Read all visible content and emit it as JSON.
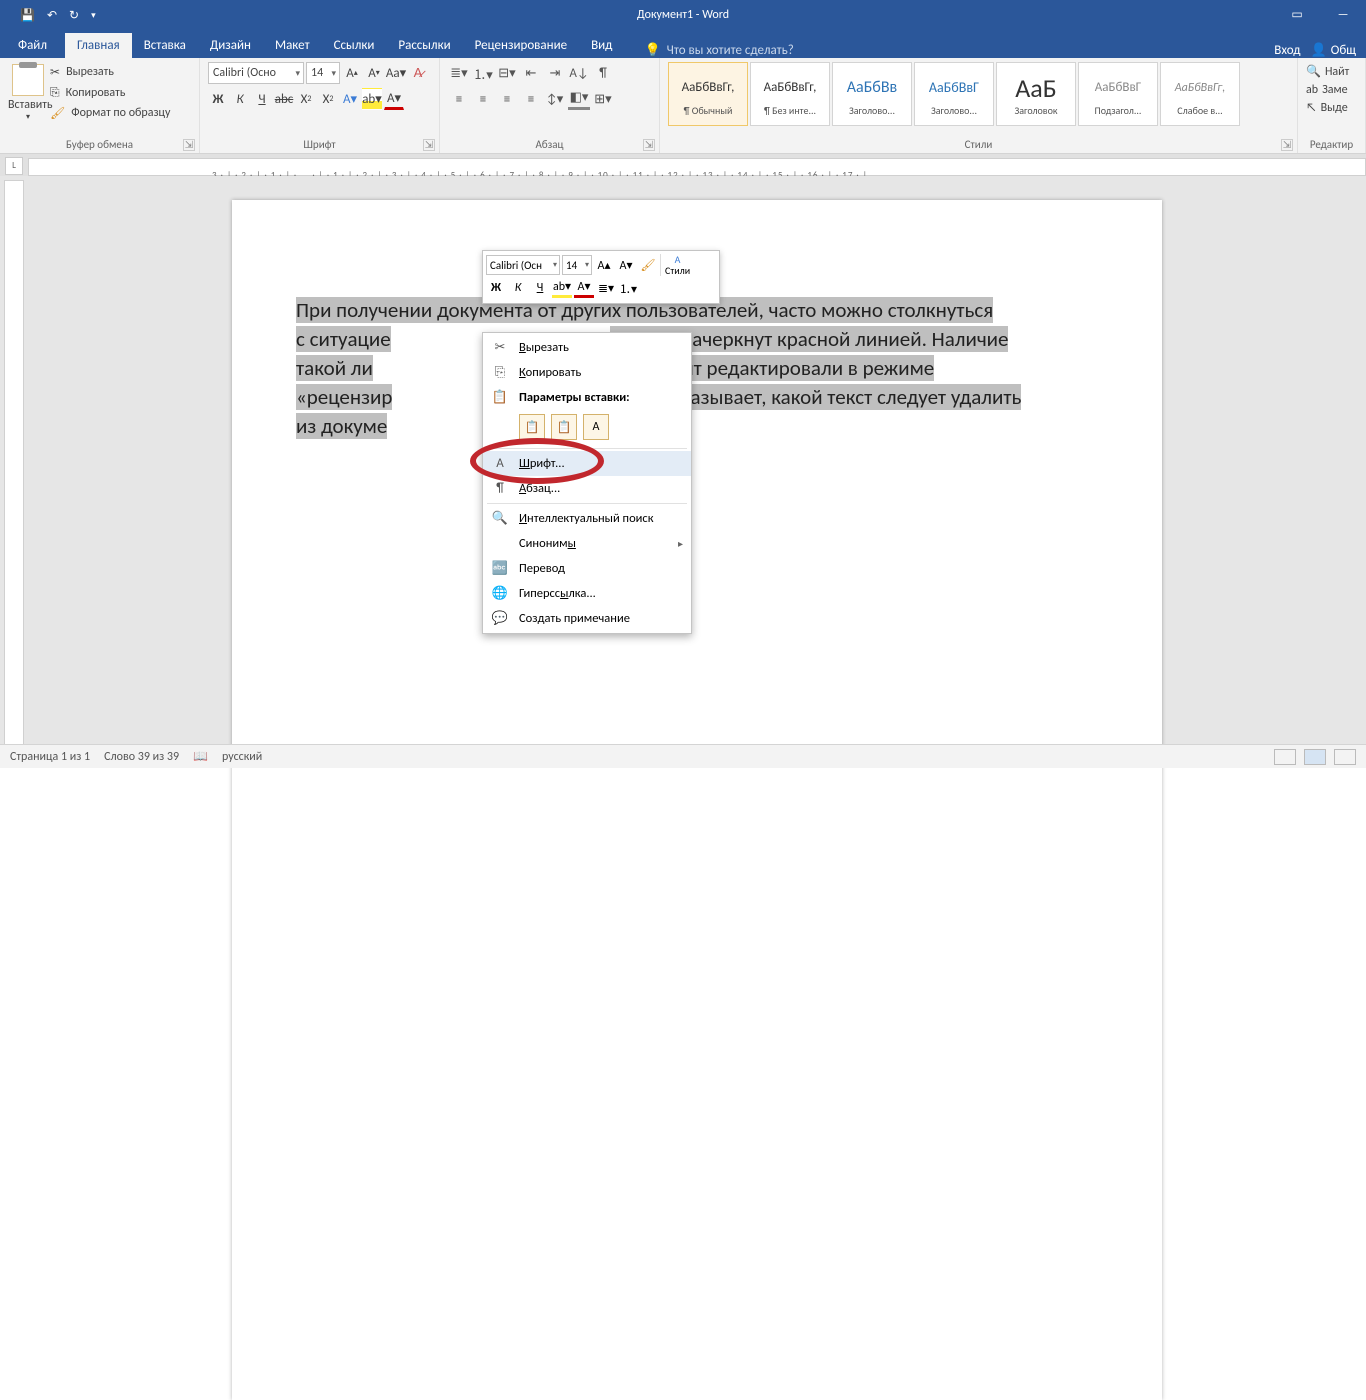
{
  "titlebar": {
    "title": "Документ1 - Word"
  },
  "tabs": {
    "file": "Файл",
    "items": [
      "Главная",
      "Вставка",
      "Дизайн",
      "Макет",
      "Ссылки",
      "Рассылки",
      "Рецензирование",
      "Вид"
    ],
    "tell_me": "Что вы хотите сделать?",
    "signin": "Вход",
    "share": "Общ"
  },
  "clipboard": {
    "paste": "Вставить",
    "cut": "Вырезать",
    "copy": "Копировать",
    "format_painter": "Формат по образцу",
    "group": "Буфер обмена"
  },
  "font": {
    "name": "Calibri (Осно",
    "size": "14",
    "group": "Шрифт"
  },
  "paragraph": {
    "group": "Абзац"
  },
  "styles": {
    "group": "Стили",
    "items": [
      {
        "preview": "АаБбВвГг,",
        "name": "¶ Обычный",
        "sel": true,
        "color": "#333",
        "fs": "13px"
      },
      {
        "preview": "АаБбВвГг,",
        "name": "¶ Без инте...",
        "color": "#333",
        "fs": "13px"
      },
      {
        "preview": "АаБбВв",
        "name": "Заголово...",
        "color": "#2e74b5",
        "fs": "16px"
      },
      {
        "preview": "АаБбВвГ",
        "name": "Заголово...",
        "color": "#2e74b5",
        "fs": "14px"
      },
      {
        "preview": "АаБ",
        "name": "Заголовок",
        "color": "#333",
        "fs": "26px"
      },
      {
        "preview": "АаБбВвГ",
        "name": "Подзагол...",
        "color": "#888",
        "fs": "13px"
      },
      {
        "preview": "АаБбВвГг,",
        "name": "Слабое в...",
        "color": "#888",
        "fs": "12px",
        "italic": true
      }
    ]
  },
  "editing": {
    "find": "Найт",
    "replace": "Заме",
    "select": "Выде",
    "group": "Редактир"
  },
  "document": {
    "line1a": "При получении документа от других пользователей, часто можно столкнуться",
    "line2a": "с ситуацие",
    "line2b": "сь текст зачеркнут красной линией. Наличие",
    "line3a": "такой   ли",
    "line3b": "то   документ   редактировали   в   режиме",
    "line4a": "«рецензир",
    "line4b": "иняя показывает, какой текст следует удалить",
    "line5a": "из докуме"
  },
  "mini": {
    "font": "Calibri (Осн",
    "size": "14",
    "styles": "Стили"
  },
  "context": {
    "cut": "Вырезать",
    "copy": "Копировать",
    "paste_opts": "Параметры вставки:",
    "font": "Шрифт...",
    "paragraph": "Абзац...",
    "smart": "Интеллектуальный поиск",
    "synonyms": "Синонимы",
    "translate": "Перевод",
    "hyperlink": "Гиперссылка...",
    "comment": "Создать примечание"
  },
  "status": {
    "page": "Страница 1 из 1",
    "words": "Слово 39 из 39",
    "lang": "русский"
  }
}
